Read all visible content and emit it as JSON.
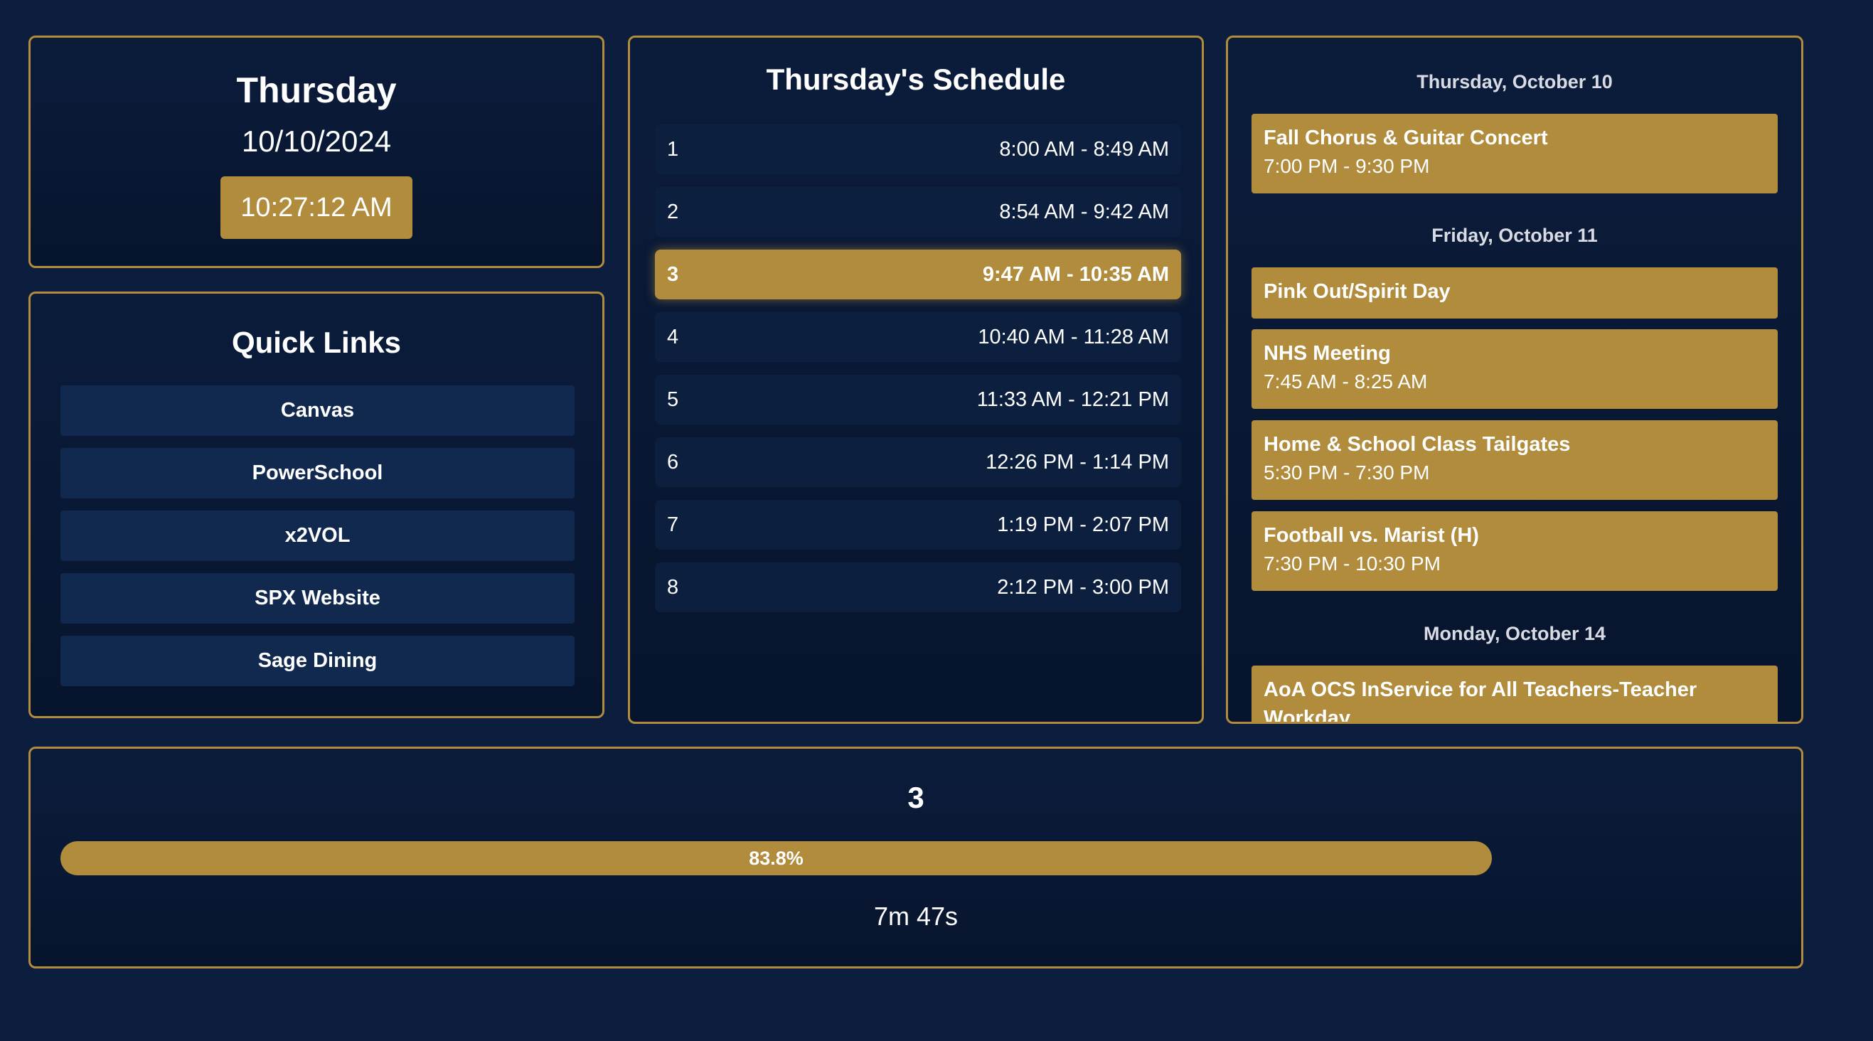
{
  "date_panel": {
    "day": "Thursday",
    "date": "10/10/2024",
    "time": "10:27:12 AM"
  },
  "quick_links": {
    "title": "Quick Links",
    "items": [
      "Canvas",
      "PowerSchool",
      "x2VOL",
      "SPX Website",
      "Sage Dining"
    ]
  },
  "schedule": {
    "title": "Thursday's Schedule",
    "active_period": "3",
    "periods": [
      {
        "period": "1",
        "time": "8:00 AM - 8:49 AM"
      },
      {
        "period": "2",
        "time": "8:54 AM - 9:42 AM"
      },
      {
        "period": "3",
        "time": "9:47 AM - 10:35 AM"
      },
      {
        "period": "4",
        "time": "10:40 AM - 11:28 AM"
      },
      {
        "period": "5",
        "time": "11:33 AM - 12:21 PM"
      },
      {
        "period": "6",
        "time": "12:26 PM - 1:14 PM"
      },
      {
        "period": "7",
        "time": "1:19 PM - 2:07 PM"
      },
      {
        "period": "8",
        "time": "2:12 PM - 3:00 PM"
      }
    ]
  },
  "events": {
    "days": [
      {
        "date": "Thursday, October 10",
        "items": [
          {
            "title": "Fall Chorus & Guitar Concert",
            "time": "7:00 PM - 9:30 PM"
          }
        ]
      },
      {
        "date": "Friday, October 11",
        "items": [
          {
            "title": "Pink Out/Spirit Day",
            "time": ""
          },
          {
            "title": "NHS Meeting",
            "time": "7:45 AM - 8:25 AM"
          },
          {
            "title": "Home & School Class Tailgates",
            "time": "5:30 PM - 7:30 PM"
          },
          {
            "title": "Football vs. Marist (H)",
            "time": "7:30 PM - 10:30 PM"
          }
        ]
      },
      {
        "date": "Monday, October 14",
        "items": [
          {
            "title": "AoA OCS InService for All Teachers-Teacher Workday",
            "time": ""
          }
        ]
      }
    ]
  },
  "progress": {
    "current_period": "3",
    "percent_label": "83.8%",
    "fraction": 0.838,
    "remaining": "7m 47s"
  },
  "colors": {
    "background": "#0d1d3d",
    "accent_gold": "#b08c3c",
    "link_button": "#11294f"
  }
}
